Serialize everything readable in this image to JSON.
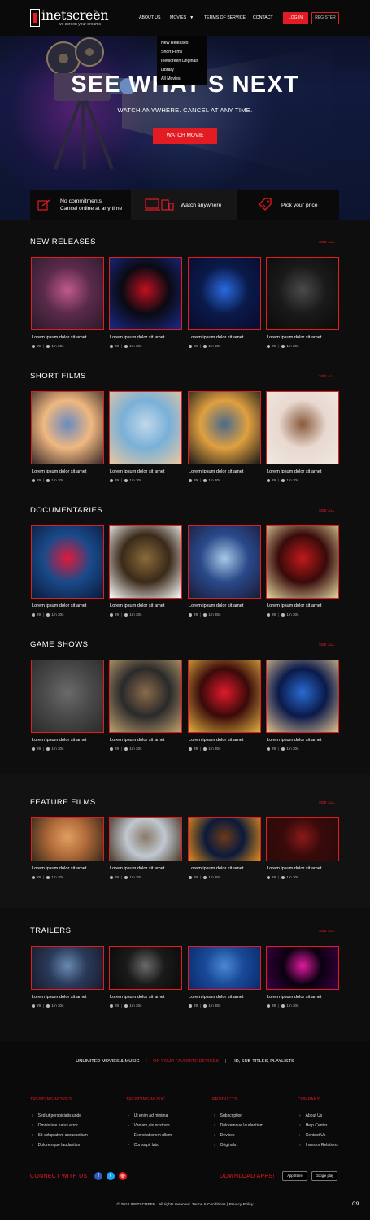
{
  "brand": {
    "name": "inetscreen",
    "tagline": "we screen your dreams",
    "tm": "TM"
  },
  "nav": {
    "about": "ABOUT US",
    "movies": "MOVIES",
    "terms": "TERMS OF SERVICE",
    "contact": "CONTACT",
    "login": "LOG IN",
    "register": "REGISTER"
  },
  "dropdown": {
    "items": [
      "New Releases",
      "Short Films",
      "Inetscreen Originals",
      "Library",
      "All Movies"
    ]
  },
  "hero": {
    "title": "SEE WHAT'S NEXT",
    "subtitle": "WATCH ANYWHERE. CANCEL AT ANY TIME.",
    "button": "WATCH MOVIE"
  },
  "features": [
    {
      "line1": "No commitments",
      "line2": "Cancel online at any time"
    },
    {
      "line1": "Watch anywhere",
      "line2": ""
    },
    {
      "line1": "Pick your price",
      "line2": ""
    }
  ],
  "card_defaults": {
    "title": "Lorem ipsum dolor sit amet",
    "comments": "29",
    "duration": "1m 30s"
  },
  "see_all": "SEE ALL ›",
  "sections": [
    {
      "title": "NEW RELEASES"
    },
    {
      "title": "SHORT FILMS"
    },
    {
      "title": "DOCUMENTARIES"
    },
    {
      "title": "GAME SHOWS"
    },
    {
      "title": "FEATURE FILMS"
    },
    {
      "title": "TRAILERS"
    }
  ],
  "footer": {
    "strap_a": "UNLIMITED MOVIES & MUSIC",
    "strap_b": "ON YOUR FAVORITE DEVICES",
    "strap_c": "HD, SUB-TITLES, PLAYLISTS",
    "columns": [
      {
        "title": "TRENDING MOVIES",
        "links": [
          "Sed ut perspiciatis unde",
          "Omnis iste natus error",
          "Sit voluptatem accusantium",
          "Doloremque laudantium"
        ]
      },
      {
        "title": "TRENDING MUSIC",
        "links": [
          "Ut enim ad minima",
          "Veniam,uis nostrum",
          "Exercitationem ullam",
          "Corporpit labo"
        ]
      },
      {
        "title": "PRODUCTS",
        "links": [
          "Subscription",
          "Doloremque laudantium",
          "Devices",
          "Originals"
        ]
      },
      {
        "title": "COMPANY",
        "links": [
          "About Us",
          "Help Center",
          "Contact Us",
          "Investor Relations"
        ]
      }
    ],
    "connect": "CONNECT WITH US",
    "social": [
      "f",
      "t",
      "◎"
    ],
    "download": "DOWNLOAD APPS!",
    "app_store": "App Store",
    "google_play": "Google play",
    "copyright": "© 2018 INETSCREEN . All rights reserved. Terms & Conditions | Privacy Policy",
    "page_badge": "C9"
  },
  "colors": {
    "accent": "#e31b23",
    "background": "#0e0e0e",
    "band": "#121212"
  }
}
